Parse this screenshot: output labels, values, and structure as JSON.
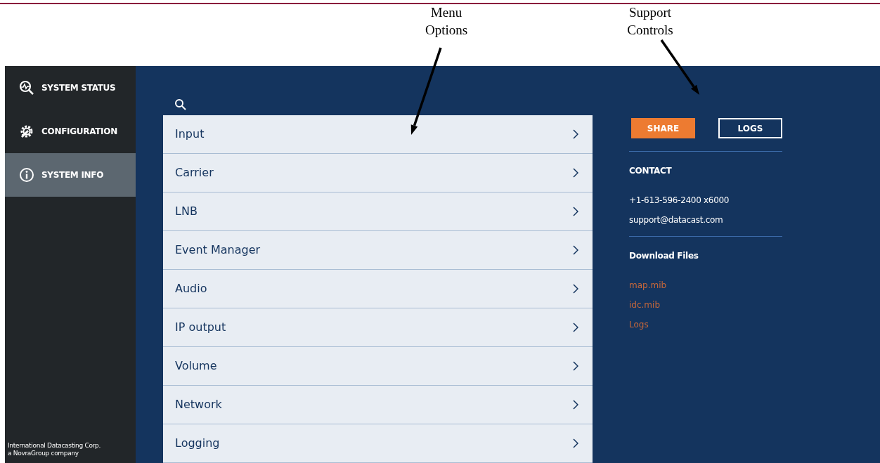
{
  "annotations": [
    {
      "kind": "menu",
      "label": "Menu\nOptions"
    },
    {
      "kind": "support",
      "label": "Support\nControls"
    }
  ],
  "sidebar": {
    "items": [
      {
        "kind": "status",
        "label": "SYSTEM STATUS",
        "selected": false
      },
      {
        "kind": "config",
        "label": "CONFIGURATION",
        "selected": false
      },
      {
        "kind": "info",
        "label": "SYSTEM INFO",
        "selected": true
      }
    ],
    "footer": [
      "International Datacasting Corp.",
      "a NovraGroup company"
    ]
  },
  "menu": {
    "items": [
      {
        "label": "Input"
      },
      {
        "label": "Carrier"
      },
      {
        "label": "LNB"
      },
      {
        "label": "Event Manager"
      },
      {
        "label": "Audio"
      },
      {
        "label": "IP output"
      },
      {
        "label": "Volume"
      },
      {
        "label": "Network"
      },
      {
        "label": "Logging"
      }
    ]
  },
  "support": {
    "buttons": [
      {
        "kind": "primary",
        "label": "SHARE"
      },
      {
        "kind": "outline",
        "label": "LOGS"
      }
    ],
    "contact_heading": "CONTACT",
    "phone": "+1-613-596-2400 x6000",
    "email": "support@datacast.com",
    "downloads_heading": "Download Files",
    "files": [
      "map.mib",
      "idc.mib",
      "Logs"
    ]
  }
}
